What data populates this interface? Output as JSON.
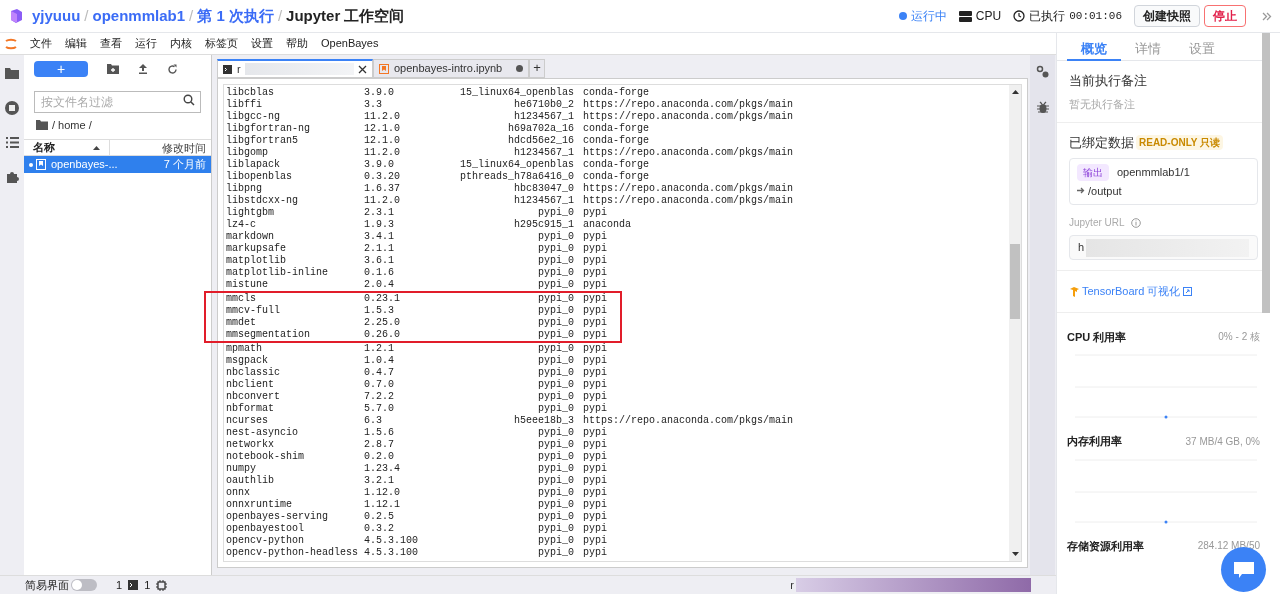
{
  "breadcrumb": [
    {
      "text": "yjyuuu",
      "kind": "link"
    },
    {
      "separator": "/",
      "text": "openmmlab1",
      "kind": "link"
    },
    {
      "separator": "/",
      "text": "第 1 次执行",
      "kind": "link"
    },
    {
      "separator": "/",
      "text": "Jupyter 工作空间",
      "kind": "current"
    }
  ],
  "status": {
    "state": "运行中",
    "resource": "CPU",
    "elapsed_label": "已执行",
    "elapsed": "00:01:06"
  },
  "actions": [
    {
      "label": "创建快照",
      "kind": "default"
    },
    {
      "label": "停止",
      "kind": "danger"
    }
  ],
  "menu": [
    "文件",
    "编辑",
    "查看",
    "运行",
    "内核",
    "标签页",
    "设置",
    "帮助",
    "OpenBayes"
  ],
  "file_browser": {
    "new_label": "+",
    "filter_placeholder": "按文件名过滤",
    "path": "/ home /",
    "columns": [
      "名称",
      "修改时间"
    ],
    "files": [
      {
        "name": "openbayes-...",
        "modified": "7 个月前",
        "selected": true
      }
    ]
  },
  "tabs": [
    {
      "title": "r",
      "kind": "terminal",
      "selected": true,
      "closable": true
    },
    {
      "title": "openbayes-intro.ipynb",
      "kind": "notebook",
      "selected": false,
      "closable": false
    }
  ],
  "add_tab": "+",
  "terminal_rows": [
    {
      "name": "libcblas",
      "version": "3.9.0",
      "build": "15_linux64_openblas",
      "channel": "conda-forge",
      "highlighted": false
    },
    {
      "name": "libffi",
      "version": "3.3",
      "build": "he6710b0_2",
      "channel": "https://repo.anaconda.com/pkgs/main",
      "highlighted": false
    },
    {
      "name": "libgcc-ng",
      "version": "11.2.0",
      "build": "h1234567_1",
      "channel": "https://repo.anaconda.com/pkgs/main",
      "highlighted": false
    },
    {
      "name": "libgfortran-ng",
      "version": "12.1.0",
      "build": "h69a702a_16",
      "channel": "conda-forge",
      "highlighted": false
    },
    {
      "name": "libgfortran5",
      "version": "12.1.0",
      "build": "hdcd56e2_16",
      "channel": "conda-forge",
      "highlighted": false
    },
    {
      "name": "libgomp",
      "version": "11.2.0",
      "build": "h1234567_1",
      "channel": "https://repo.anaconda.com/pkgs/main",
      "highlighted": false
    },
    {
      "name": "liblapack",
      "version": "3.9.0",
      "build": "15_linux64_openblas",
      "channel": "conda-forge",
      "highlighted": false
    },
    {
      "name": "libopenblas",
      "version": "0.3.20",
      "build": "pthreads_h78a6416_0",
      "channel": "conda-forge",
      "highlighted": false
    },
    {
      "name": "libpng",
      "version": "1.6.37",
      "build": "hbc83047_0",
      "channel": "https://repo.anaconda.com/pkgs/main",
      "highlighted": false
    },
    {
      "name": "libstdcxx-ng",
      "version": "11.2.0",
      "build": "h1234567_1",
      "channel": "https://repo.anaconda.com/pkgs/main",
      "highlighted": false
    },
    {
      "name": "lightgbm",
      "version": "2.3.1",
      "build": "pypi_0",
      "channel": "pypi",
      "highlighted": false
    },
    {
      "name": "lz4-c",
      "version": "1.9.3",
      "build": "h295c915_1",
      "channel": "anaconda",
      "highlighted": false
    },
    {
      "name": "markdown",
      "version": "3.4.1",
      "build": "pypi_0",
      "channel": "pypi",
      "highlighted": false
    },
    {
      "name": "markupsafe",
      "version": "2.1.1",
      "build": "pypi_0",
      "channel": "pypi",
      "highlighted": false
    },
    {
      "name": "matplotlib",
      "version": "3.6.1",
      "build": "pypi_0",
      "channel": "pypi",
      "highlighted": false
    },
    {
      "name": "matplotlib-inline",
      "version": "0.1.6",
      "build": "pypi_0",
      "channel": "pypi",
      "highlighted": false
    },
    {
      "name": "mistune",
      "version": "2.0.4",
      "build": "pypi_0",
      "channel": "pypi",
      "highlighted": false
    },
    {
      "name": "mmcls",
      "version": "0.23.1",
      "build": "pypi_0",
      "channel": "pypi",
      "highlighted": true
    },
    {
      "name": "mmcv-full",
      "version": "1.5.3",
      "build": "pypi_0",
      "channel": "pypi",
      "highlighted": true
    },
    {
      "name": "mmdet",
      "version": "2.25.0",
      "build": "pypi_0",
      "channel": "pypi",
      "highlighted": true
    },
    {
      "name": "mmsegmentation",
      "version": "0.26.0",
      "build": "pypi_0",
      "channel": "pypi",
      "highlighted": true
    },
    {
      "name": "mpmath",
      "version": "1.2.1",
      "build": "pypi_0",
      "channel": "pypi",
      "highlighted": false
    },
    {
      "name": "msgpack",
      "version": "1.0.4",
      "build": "pypi_0",
      "channel": "pypi",
      "highlighted": false
    },
    {
      "name": "nbclassic",
      "version": "0.4.7",
      "build": "pypi_0",
      "channel": "pypi",
      "highlighted": false
    },
    {
      "name": "nbclient",
      "version": "0.7.0",
      "build": "pypi_0",
      "channel": "pypi",
      "highlighted": false
    },
    {
      "name": "nbconvert",
      "version": "7.2.2",
      "build": "pypi_0",
      "channel": "pypi",
      "highlighted": false
    },
    {
      "name": "nbformat",
      "version": "5.7.0",
      "build": "pypi_0",
      "channel": "pypi",
      "highlighted": false
    },
    {
      "name": "ncurses",
      "version": "6.3",
      "build": "h5eee18b_3",
      "channel": "https://repo.anaconda.com/pkgs/main",
      "highlighted": false
    },
    {
      "name": "nest-asyncio",
      "version": "1.5.6",
      "build": "pypi_0",
      "channel": "pypi",
      "highlighted": false
    },
    {
      "name": "networkx",
      "version": "2.8.7",
      "build": "pypi_0",
      "channel": "pypi",
      "highlighted": false
    },
    {
      "name": "notebook-shim",
      "version": "0.2.0",
      "build": "pypi_0",
      "channel": "pypi",
      "highlighted": false
    },
    {
      "name": "numpy",
      "version": "1.23.4",
      "build": "pypi_0",
      "channel": "pypi",
      "highlighted": false
    },
    {
      "name": "oauthlib",
      "version": "3.2.1",
      "build": "pypi_0",
      "channel": "pypi",
      "highlighted": false
    },
    {
      "name": "onnx",
      "version": "1.12.0",
      "build": "pypi_0",
      "channel": "pypi",
      "highlighted": false
    },
    {
      "name": "onnxruntime",
      "version": "1.12.1",
      "build": "pypi_0",
      "channel": "pypi",
      "highlighted": false
    },
    {
      "name": "openbayes-serving",
      "version": "0.2.5",
      "build": "pypi_0",
      "channel": "pypi",
      "highlighted": false
    },
    {
      "name": "openbayestool",
      "version": "0.3.2",
      "build": "pypi_0",
      "channel": "pypi",
      "highlighted": false
    },
    {
      "name": "opencv-python",
      "version": "4.5.3.100",
      "build": "pypi_0",
      "channel": "pypi",
      "highlighted": false
    },
    {
      "name": "opencv-python-headless",
      "version": "4.5.3.100",
      "build": "pypi_0",
      "channel": "pypi",
      "highlighted": false
    }
  ],
  "right_panel": {
    "tabs": [
      {
        "label": "概览",
        "selected": true
      },
      {
        "label": "详情",
        "selected": false
      },
      {
        "label": "设置",
        "selected": false
      }
    ],
    "note_title": "当前执行备注",
    "note_text": "暂无执行备注",
    "bound_title": "已绑定数据",
    "bound_badge": "READ-ONLY 只读",
    "binding": {
      "tag": "输出",
      "source": "openmmlab1/1",
      "target": "/output"
    },
    "url_label": "Jupyter URL",
    "url_value": "h",
    "tensorboard": "TensorBoard 可视化",
    "metrics": [
      {
        "title": "CPU 利用率",
        "reading": "0% - 2 核"
      },
      {
        "title": "内存利用率",
        "reading": "37 MB/4 GB, 0%"
      },
      {
        "title": "存储资源利用率",
        "reading": "284.12 MB/50"
      }
    ]
  },
  "status_bar": {
    "simple_mode": "简易界面",
    "simple_on": false,
    "kernels": "1",
    "terminals": "1",
    "right_text": "r"
  }
}
